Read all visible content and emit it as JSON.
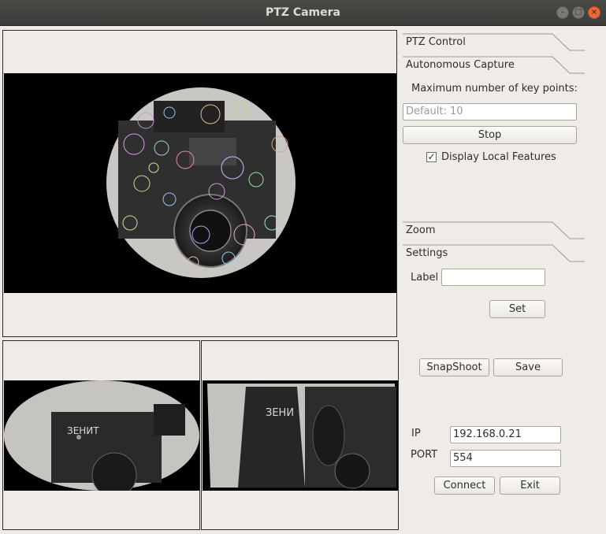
{
  "window": {
    "title": "PTZ Camera"
  },
  "tabs": {
    "ptz_control": "PTZ Control",
    "autonomous_capture": "Autonomous Capture",
    "zoom": "Zoom",
    "settings": "Settings"
  },
  "capture": {
    "max_keypoints_label": "Maximum number of key points:",
    "max_keypoints_placeholder": "Default: 10",
    "stop_label": "Stop",
    "display_features_label": "Display Local Features",
    "display_features_checked": true
  },
  "settings": {
    "label_label": "Label",
    "label_value": "",
    "set_label": "Set"
  },
  "actions": {
    "snapshot_label": "SnapShoot",
    "save_label": "Save"
  },
  "connection": {
    "ip_label": "IP",
    "ip_value": "192.168.0.21",
    "port_label": "PORT",
    "port_value": "554",
    "connect_label": "Connect",
    "exit_label": "Exit"
  },
  "images": {
    "bottom_left_text": "ЗЕНИТ",
    "bottom_right_text": "ЗЕНИ"
  }
}
